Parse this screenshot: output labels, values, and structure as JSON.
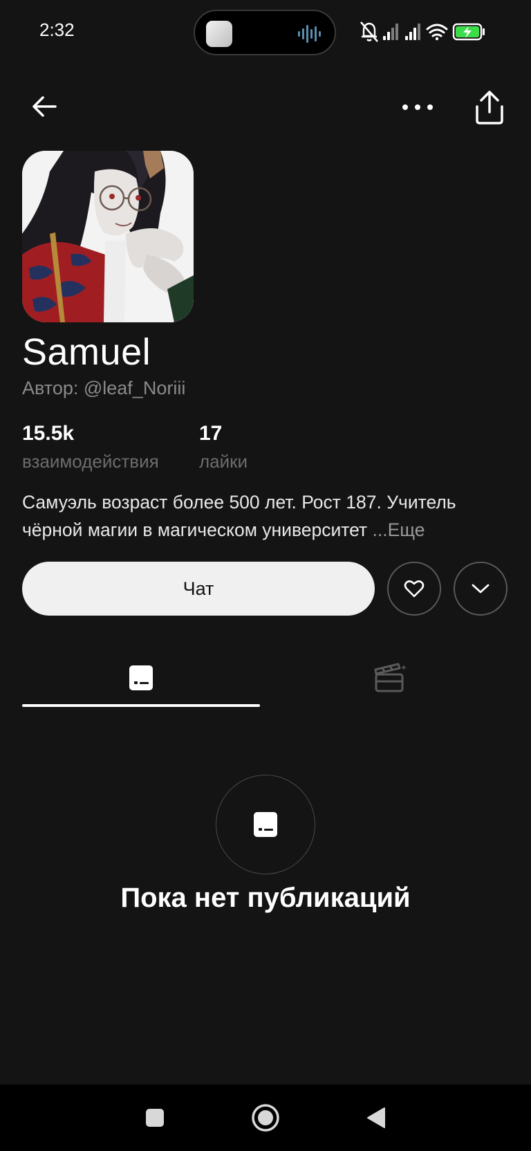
{
  "status_bar": {
    "time": "2:32",
    "icons": [
      "music-thumbnail-icon",
      "audio-wave-icon",
      "bell-off-icon",
      "signal-icon",
      "signal-icon",
      "wifi-icon",
      "battery-charging-icon"
    ],
    "battery_color": "#3ddc4a"
  },
  "top_bar": {
    "icons": [
      "back-arrow-icon",
      "more-dots-icon",
      "share-icon"
    ]
  },
  "profile": {
    "name": "Samuel",
    "author": "Автор: @leaf_Noriii",
    "stats": [
      {
        "value": "15.5k",
        "label": "взаимодействия"
      },
      {
        "value": "17",
        "label": "лайки"
      }
    ],
    "description_line1": "Самуэль возраст более 500 лет. Рост 187. Учитель",
    "description_line2": "чёрной магии в магическом университет ",
    "more_label": "...Еще"
  },
  "actions": {
    "chat_label": "Чат",
    "icons": [
      "heart-icon",
      "chevron-down-icon"
    ]
  },
  "tabs": [
    {
      "icon": "chat-bubble-icon",
      "active": true
    },
    {
      "icon": "clapperboard-icon",
      "active": false
    }
  ],
  "empty_state": {
    "icon": "chat-bubble-icon",
    "text": "Пока нет публикаций"
  },
  "nav_bar": {
    "icons": [
      "recents-square-icon",
      "home-circle-icon",
      "back-triangle-icon"
    ]
  },
  "colors": {
    "background": "#141414",
    "text_primary": "#ffffff",
    "text_muted": "#6d6d6d",
    "chat_button_bg": "#f0f0f0",
    "nav_bg": "#000000"
  }
}
